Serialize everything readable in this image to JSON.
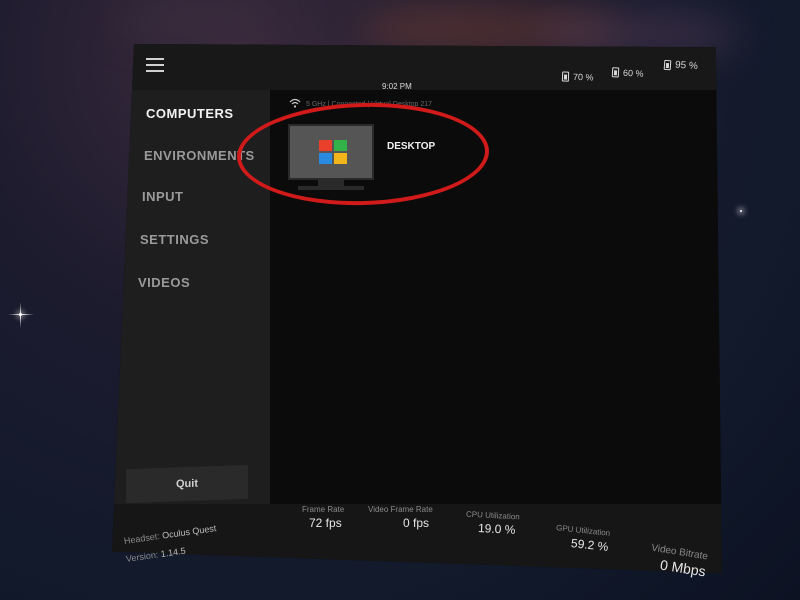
{
  "topbar": {
    "time": "9:02 PM",
    "batteries": [
      {
        "label": "70 %"
      },
      {
        "label": "60 %"
      },
      {
        "label": "95 %"
      }
    ]
  },
  "sidebar": {
    "items": [
      {
        "label": "COMPUTERS",
        "active": true
      },
      {
        "label": "ENVIRONMENTS",
        "active": false
      },
      {
        "label": "INPUT",
        "active": false
      },
      {
        "label": "SETTINGS",
        "active": false
      },
      {
        "label": "VIDEOS",
        "active": false
      }
    ],
    "quit_label": "Quit"
  },
  "network": {
    "info": "5 GHz | Connected | Virtual Desktop 217"
  },
  "computers": [
    {
      "name": "DESKTOP",
      "icon": "windows-monitor-icon"
    }
  ],
  "footer": {
    "headset_label": "Headset:",
    "headset_value": "Oculus Quest",
    "version_label": "Version:",
    "version_value": "1.14.5",
    "stats": [
      {
        "label": "Frame Rate",
        "value": "72 fps"
      },
      {
        "label": "Video Frame Rate",
        "value": "0 fps"
      },
      {
        "label": "CPU Utilization",
        "value": "19.0 %"
      },
      {
        "label": "GPU Utilization",
        "value": "59.2 %"
      },
      {
        "label": "Video Bitrate",
        "value": "0 Mbps"
      }
    ]
  },
  "colors": {
    "highlight_ellipse": "#d11a1a",
    "windows_logo": [
      "#e8402a",
      "#33b24a",
      "#2a8ae0",
      "#f3b51c"
    ]
  }
}
